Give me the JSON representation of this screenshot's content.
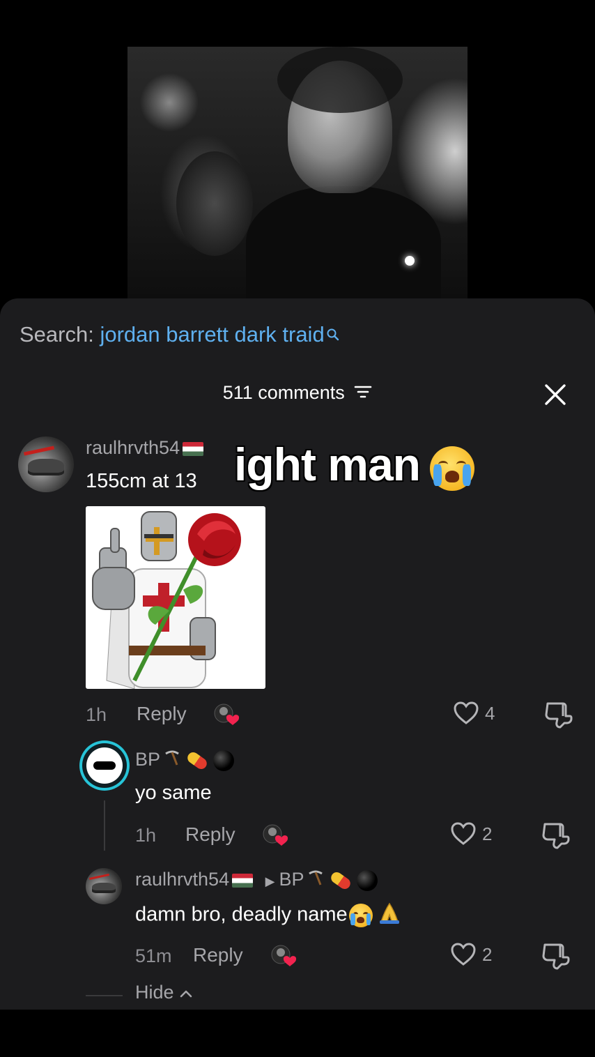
{
  "search": {
    "label": "Search:",
    "query": "jordan barrett dark traid"
  },
  "comments_header": {
    "count_label": "511 comments"
  },
  "overlay_caption": "ight man",
  "comments": [
    {
      "username": "raulhrvth54",
      "text": "155cm at 13",
      "time": "1h",
      "reply_label": "Reply",
      "likes": "4"
    }
  ],
  "replies": [
    {
      "username": "BP",
      "text": "yo same",
      "time": "1h",
      "reply_label": "Reply",
      "likes": "2"
    },
    {
      "username": "raulhrvth54",
      "reply_to": "BP",
      "text": "damn bro, deadly name",
      "time": "51m",
      "reply_label": "Reply",
      "likes": "2"
    }
  ],
  "hide_label": "Hide",
  "colors": {
    "link": "#5fb0ef",
    "sheet": "#1c1c1e",
    "muted": "#a6a6aa",
    "ring": "#27c4d8"
  }
}
